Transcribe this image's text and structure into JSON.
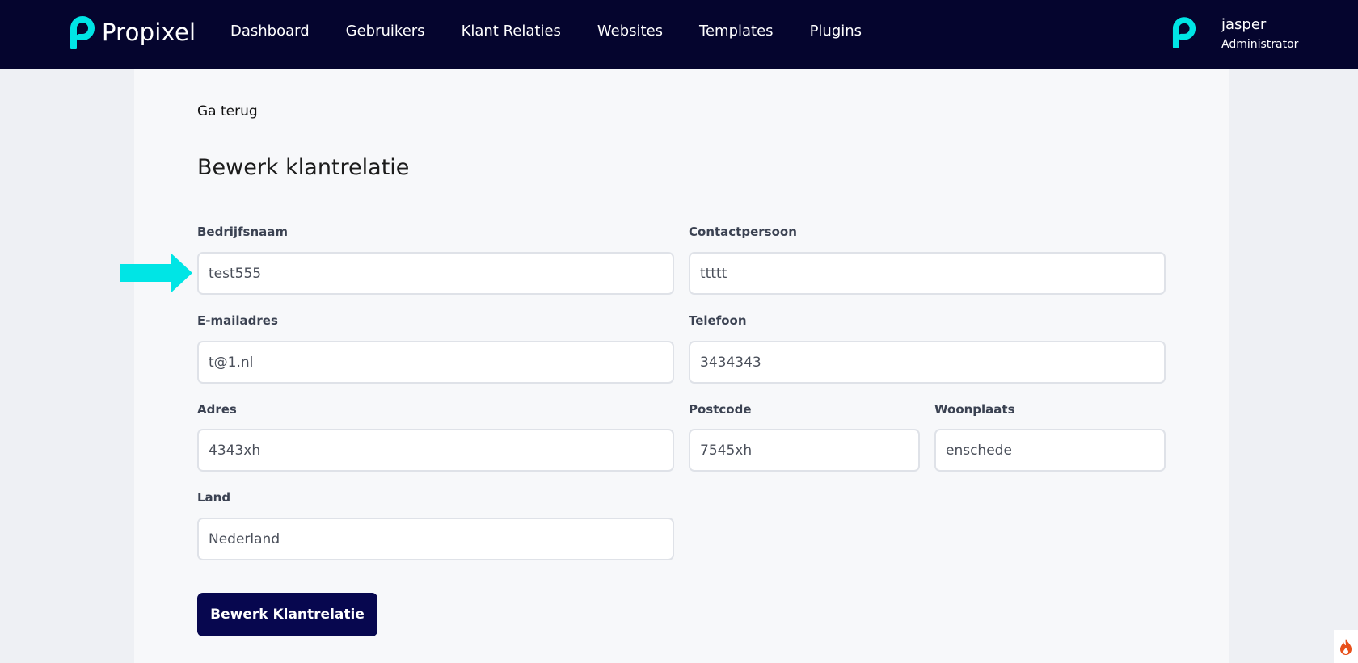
{
  "header": {
    "brand": "Propixel",
    "nav": [
      {
        "label": "Dashboard"
      },
      {
        "label": "Gebruikers"
      },
      {
        "label": "Klant Relaties"
      },
      {
        "label": "Websites"
      },
      {
        "label": "Templates"
      },
      {
        "label": "Plugins"
      }
    ],
    "user": {
      "name": "jasper",
      "role": "Administrator"
    }
  },
  "main": {
    "back_label": "Ga terug",
    "title": "Bewerk klantrelatie",
    "fields": {
      "bedrijfsnaam": {
        "label": "Bedrijfsnaam",
        "value": "test555"
      },
      "contactpersoon": {
        "label": "Contactpersoon",
        "value": "ttttt"
      },
      "email": {
        "label": "E-mailadres",
        "value": "t@1.nl"
      },
      "telefoon": {
        "label": "Telefoon",
        "value": "3434343"
      },
      "adres": {
        "label": "Adres",
        "value": "4343xh"
      },
      "postcode": {
        "label": "Postcode",
        "value": "7545xh"
      },
      "woonplaats": {
        "label": "Woonplaats",
        "value": "enschede"
      },
      "land": {
        "label": "Land",
        "value": "Nederland"
      }
    },
    "submit_label": "Bewerk Klantrelatie"
  },
  "colors": {
    "header_bg": "#05052e",
    "accent": "#00e5e5",
    "button_bg": "#07074f"
  },
  "icons": {
    "brand_logo": "propixel-p-logo-icon",
    "highlight": "arrow-right-icon",
    "corner": "flame-icon"
  }
}
